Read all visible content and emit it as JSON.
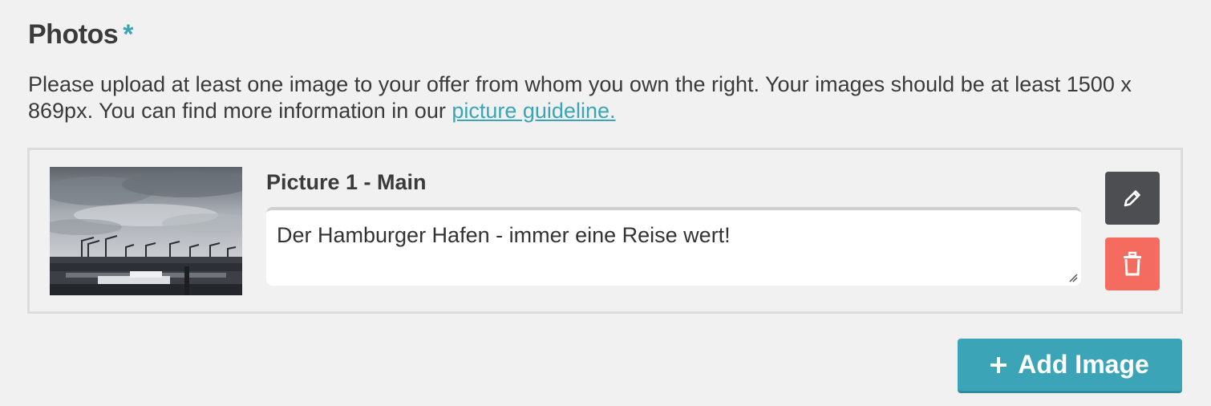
{
  "section": {
    "title": "Photos",
    "required_marker": "*",
    "description_text": "Please upload at least one image to your offer from whom you own the right. Your images should be at least 1500 x 869px. You can find more information in our ",
    "guideline_link": "picture guideline."
  },
  "photos": [
    {
      "label": "Picture 1 - Main",
      "caption": "Der Hamburger Hafen - immer eine Reise wert!",
      "thumbnail_icon": "harbor-photo",
      "edit_icon": "pencil-icon",
      "delete_icon": "trash-icon"
    }
  ],
  "actions": {
    "add_icon": "plus-icon",
    "add_label": "Add Image"
  },
  "colors": {
    "accent": "#3ba5b7",
    "edit_button": "#4d4e52",
    "delete_button": "#f46b60",
    "background": "#f1f1f1"
  }
}
